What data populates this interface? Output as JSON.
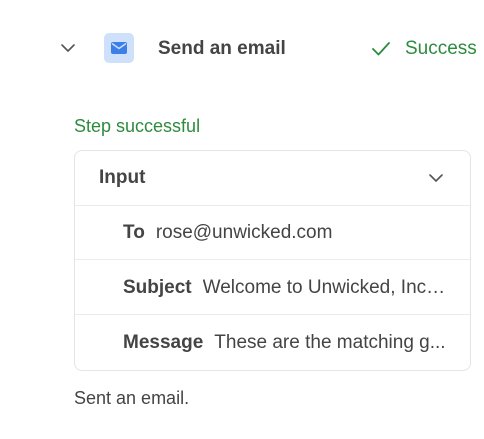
{
  "step": {
    "title": "Send an email",
    "status": "Success",
    "icon": "envelope-icon",
    "toggle_icon": "chevron-down-icon",
    "colors": {
      "success": "#2e8b3e",
      "icon_bg": "#cfe0fb",
      "icon_fg": "#3d7ee8"
    }
  },
  "result": {
    "title": "Step successful",
    "message": "Sent an email."
  },
  "input": {
    "header_label": "Input",
    "fields": [
      {
        "label": "To",
        "value": "rose@unwicked.com"
      },
      {
        "label": "Subject",
        "value": "Welcome to Unwicked, Inc...."
      },
      {
        "label": "Message",
        "value": "These are the matching g..."
      }
    ]
  }
}
